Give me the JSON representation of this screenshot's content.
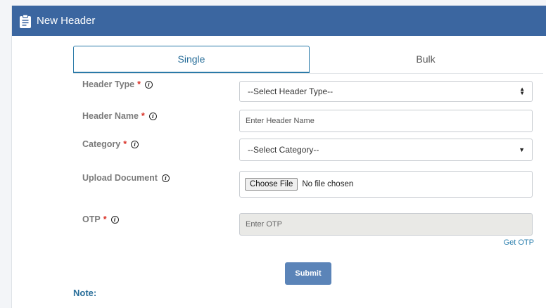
{
  "header": {
    "title": "New Header",
    "icon": "clipboard-icon"
  },
  "tabs": [
    {
      "label": "Single",
      "active": true
    },
    {
      "label": "Bulk",
      "active": false
    }
  ],
  "form": {
    "header_type": {
      "label": "Header Type",
      "required": "*",
      "selected": "--Select Header Type--"
    },
    "header_name": {
      "label": "Header Name",
      "required": "*",
      "placeholder": "Enter Header Name"
    },
    "category": {
      "label": "Category",
      "required": "*",
      "selected": "--Select Category--"
    },
    "upload": {
      "label": "Upload Document",
      "button": "Choose File",
      "status": "No file chosen"
    },
    "otp": {
      "label": "OTP",
      "required": "*",
      "placeholder": "Enter OTP",
      "get_otp": "Get OTP"
    }
  },
  "submit_label": "Submit",
  "note_label": "Note:",
  "colors": {
    "header_bg": "#3b66a0",
    "accent": "#2a7aa8",
    "required": "#d93025",
    "submit": "#5b84b8"
  }
}
